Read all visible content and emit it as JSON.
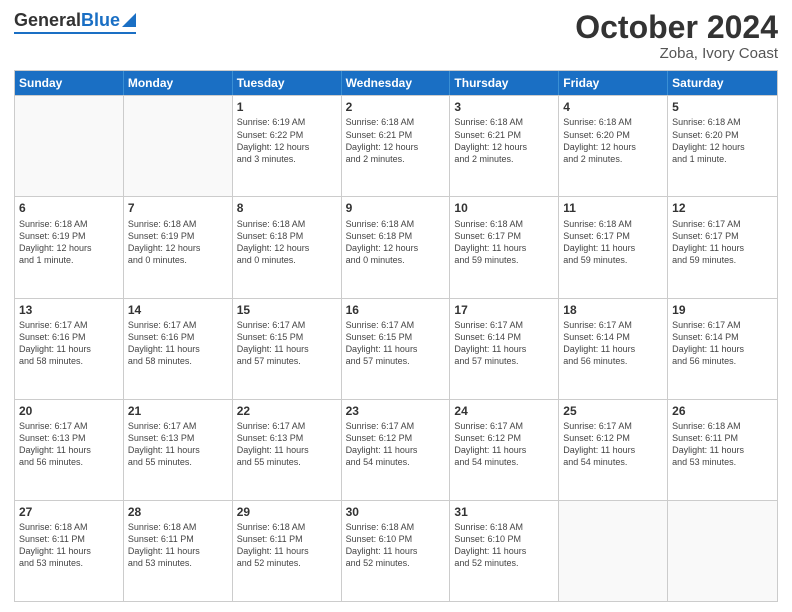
{
  "header": {
    "logo": {
      "general": "General",
      "blue": "Blue"
    },
    "title": "October 2024",
    "location": "Zoba, Ivory Coast"
  },
  "days": [
    "Sunday",
    "Monday",
    "Tuesday",
    "Wednesday",
    "Thursday",
    "Friday",
    "Saturday"
  ],
  "weeks": [
    [
      {
        "day": "",
        "content": ""
      },
      {
        "day": "",
        "content": ""
      },
      {
        "day": "1",
        "content": "Sunrise: 6:19 AM\nSunset: 6:22 PM\nDaylight: 12 hours\nand 3 minutes."
      },
      {
        "day": "2",
        "content": "Sunrise: 6:18 AM\nSunset: 6:21 PM\nDaylight: 12 hours\nand 2 minutes."
      },
      {
        "day": "3",
        "content": "Sunrise: 6:18 AM\nSunset: 6:21 PM\nDaylight: 12 hours\nand 2 minutes."
      },
      {
        "day": "4",
        "content": "Sunrise: 6:18 AM\nSunset: 6:20 PM\nDaylight: 12 hours\nand 2 minutes."
      },
      {
        "day": "5",
        "content": "Sunrise: 6:18 AM\nSunset: 6:20 PM\nDaylight: 12 hours\nand 1 minute."
      }
    ],
    [
      {
        "day": "6",
        "content": "Sunrise: 6:18 AM\nSunset: 6:19 PM\nDaylight: 12 hours\nand 1 minute."
      },
      {
        "day": "7",
        "content": "Sunrise: 6:18 AM\nSunset: 6:19 PM\nDaylight: 12 hours\nand 0 minutes."
      },
      {
        "day": "8",
        "content": "Sunrise: 6:18 AM\nSunset: 6:18 PM\nDaylight: 12 hours\nand 0 minutes."
      },
      {
        "day": "9",
        "content": "Sunrise: 6:18 AM\nSunset: 6:18 PM\nDaylight: 12 hours\nand 0 minutes."
      },
      {
        "day": "10",
        "content": "Sunrise: 6:18 AM\nSunset: 6:17 PM\nDaylight: 11 hours\nand 59 minutes."
      },
      {
        "day": "11",
        "content": "Sunrise: 6:18 AM\nSunset: 6:17 PM\nDaylight: 11 hours\nand 59 minutes."
      },
      {
        "day": "12",
        "content": "Sunrise: 6:17 AM\nSunset: 6:17 PM\nDaylight: 11 hours\nand 59 minutes."
      }
    ],
    [
      {
        "day": "13",
        "content": "Sunrise: 6:17 AM\nSunset: 6:16 PM\nDaylight: 11 hours\nand 58 minutes."
      },
      {
        "day": "14",
        "content": "Sunrise: 6:17 AM\nSunset: 6:16 PM\nDaylight: 11 hours\nand 58 minutes."
      },
      {
        "day": "15",
        "content": "Sunrise: 6:17 AM\nSunset: 6:15 PM\nDaylight: 11 hours\nand 57 minutes."
      },
      {
        "day": "16",
        "content": "Sunrise: 6:17 AM\nSunset: 6:15 PM\nDaylight: 11 hours\nand 57 minutes."
      },
      {
        "day": "17",
        "content": "Sunrise: 6:17 AM\nSunset: 6:14 PM\nDaylight: 11 hours\nand 57 minutes."
      },
      {
        "day": "18",
        "content": "Sunrise: 6:17 AM\nSunset: 6:14 PM\nDaylight: 11 hours\nand 56 minutes."
      },
      {
        "day": "19",
        "content": "Sunrise: 6:17 AM\nSunset: 6:14 PM\nDaylight: 11 hours\nand 56 minutes."
      }
    ],
    [
      {
        "day": "20",
        "content": "Sunrise: 6:17 AM\nSunset: 6:13 PM\nDaylight: 11 hours\nand 56 minutes."
      },
      {
        "day": "21",
        "content": "Sunrise: 6:17 AM\nSunset: 6:13 PM\nDaylight: 11 hours\nand 55 minutes."
      },
      {
        "day": "22",
        "content": "Sunrise: 6:17 AM\nSunset: 6:13 PM\nDaylight: 11 hours\nand 55 minutes."
      },
      {
        "day": "23",
        "content": "Sunrise: 6:17 AM\nSunset: 6:12 PM\nDaylight: 11 hours\nand 54 minutes."
      },
      {
        "day": "24",
        "content": "Sunrise: 6:17 AM\nSunset: 6:12 PM\nDaylight: 11 hours\nand 54 minutes."
      },
      {
        "day": "25",
        "content": "Sunrise: 6:17 AM\nSunset: 6:12 PM\nDaylight: 11 hours\nand 54 minutes."
      },
      {
        "day": "26",
        "content": "Sunrise: 6:18 AM\nSunset: 6:11 PM\nDaylight: 11 hours\nand 53 minutes."
      }
    ],
    [
      {
        "day": "27",
        "content": "Sunrise: 6:18 AM\nSunset: 6:11 PM\nDaylight: 11 hours\nand 53 minutes."
      },
      {
        "day": "28",
        "content": "Sunrise: 6:18 AM\nSunset: 6:11 PM\nDaylight: 11 hours\nand 53 minutes."
      },
      {
        "day": "29",
        "content": "Sunrise: 6:18 AM\nSunset: 6:11 PM\nDaylight: 11 hours\nand 52 minutes."
      },
      {
        "day": "30",
        "content": "Sunrise: 6:18 AM\nSunset: 6:10 PM\nDaylight: 11 hours\nand 52 minutes."
      },
      {
        "day": "31",
        "content": "Sunrise: 6:18 AM\nSunset: 6:10 PM\nDaylight: 11 hours\nand 52 minutes."
      },
      {
        "day": "",
        "content": ""
      },
      {
        "day": "",
        "content": ""
      }
    ]
  ]
}
